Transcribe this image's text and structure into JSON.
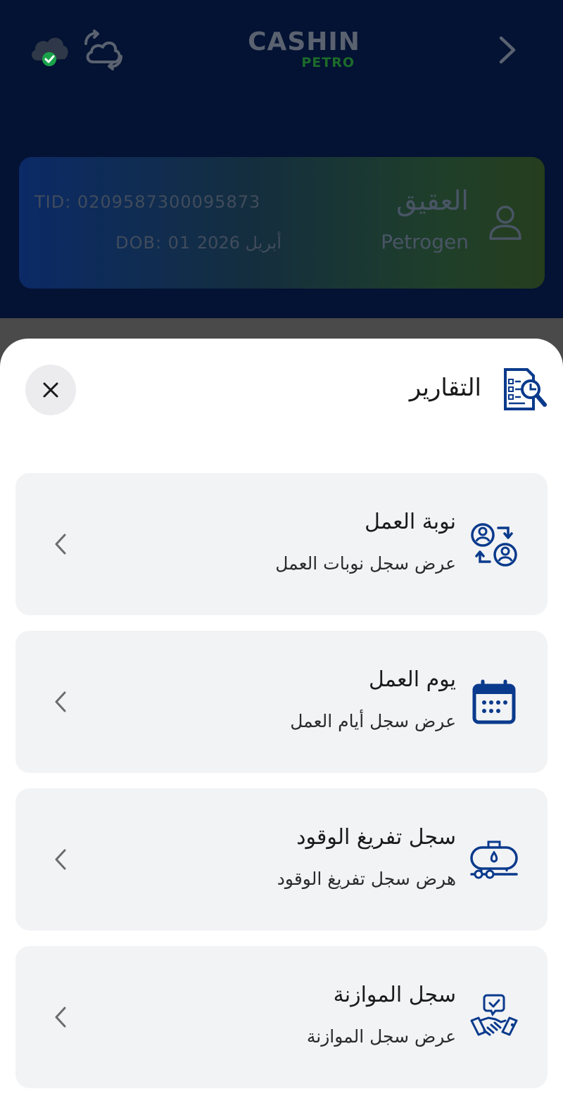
{
  "header": {
    "logo_main": "CASHIN",
    "logo_sub": "PETRO"
  },
  "station": {
    "name": "العقيق",
    "company": "Petrogen",
    "tid": "TID: 0209587300095873",
    "dob": "DOB: 01 أبريل 2026"
  },
  "sheet": {
    "title": "التقارير",
    "items": [
      {
        "title": "نوبة العمل",
        "subtitle": "عرض سجل نوبات العمل",
        "icon": "shift-swap-icon"
      },
      {
        "title": "يوم العمل",
        "subtitle": "عرض سجل أيام العمل",
        "icon": "calendar-icon"
      },
      {
        "title": "سجل تفريغ الوقود",
        "subtitle": "هرض سجل تفريغ الوقود",
        "icon": "fuel-tanker-icon"
      },
      {
        "title": "سجل الموازنة",
        "subtitle": "عرض سجل الموازنة",
        "icon": "handshake-icon"
      }
    ]
  },
  "colors": {
    "app_background": "#041233",
    "brand_blue": "#0a3a8c",
    "brand_green": "#1c6b2a",
    "card_background": "#f2f3f5",
    "sync_ok": "#1aa34a"
  }
}
